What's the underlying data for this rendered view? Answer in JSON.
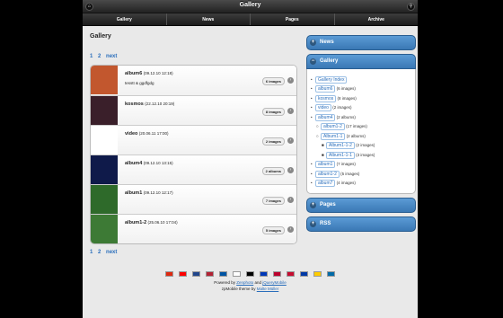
{
  "header": {
    "title": "Gallery",
    "home_icon": "home-icon",
    "search_icon": "search-icon"
  },
  "nav": [
    "Gallery",
    "News",
    "Pages",
    "Archive"
  ],
  "main": {
    "heading": "Gallery",
    "pager": {
      "page1": "1",
      "page2": "2",
      "next": "next"
    },
    "albums": [
      {
        "name": "album6",
        "date": "(09.12.10 12:18)",
        "desc": "tesstt & ggdfgdg",
        "count": "6 images",
        "thumb": "#c2572e"
      },
      {
        "name": "kosmos",
        "date": "(22.12.10 20:19)",
        "desc": "",
        "count": "8 images",
        "thumb": "#3a1f2a"
      },
      {
        "name": "video",
        "date": "(20.06.11 17:00)",
        "desc": "",
        "count": "2 images",
        "thumb": "#ffffff"
      },
      {
        "name": "album4",
        "date": "(09.12.10 13:15)",
        "desc": "",
        "count": "2 albums",
        "thumb": "#0f1a4a"
      },
      {
        "name": "album1",
        "date": "(09.12.10 12:17)",
        "desc": "",
        "count": "7 images",
        "thumb": "#2e6a2a"
      },
      {
        "name": "album1-2",
        "date": "(25.06.10 17:04)",
        "desc": "",
        "count": "5 images",
        "thumb": "#3d7a35"
      }
    ]
  },
  "sidebar": {
    "news": "News",
    "gallery": "Gallery",
    "pages": "Pages",
    "rss": "RSS",
    "tree": [
      {
        "label": "Gallery Index",
        "meta": "",
        "level": 0
      },
      {
        "label": "album6",
        "meta": "(6 images)",
        "level": 0
      },
      {
        "label": "kosmos",
        "meta": "(8 images)",
        "level": 0
      },
      {
        "label": "video",
        "meta": "(2 images)",
        "level": 0
      },
      {
        "label": "album4",
        "meta": "(2 albums)",
        "level": 0
      },
      {
        "label": "album1-2",
        "meta": "(17 images)",
        "level": 1
      },
      {
        "label": "Album1-1",
        "meta": "(2 albums)",
        "level": 1
      },
      {
        "label": "Album1-1-2",
        "meta": "(2 images)",
        "level": 2
      },
      {
        "label": "Album1-1-1",
        "meta": "(3 images)",
        "level": 2
      },
      {
        "label": "album1",
        "meta": "(7 images)",
        "level": 0
      },
      {
        "label": "album1-2",
        "meta": "(5 images)",
        "level": 0
      },
      {
        "label": "album7",
        "meta": "(4 images)",
        "level": 0
      }
    ]
  },
  "footer": {
    "line1_prefix": "Powered by",
    "zenphoto": "Zenphoto",
    "and": "and",
    "jquerymobile": "jQueryMobile",
    "line2_prefix": "zpMobile theme by",
    "author": "Malte Müller",
    "flags": [
      "#de2910",
      "#fe0000",
      "#21468b",
      "#b22234",
      "#0055a4",
      "#ffffff",
      "#000000",
      "#0038b8",
      "#bc002d",
      "#c60c30",
      "#0039a6",
      "#ffcc00",
      "#006aa7"
    ]
  }
}
